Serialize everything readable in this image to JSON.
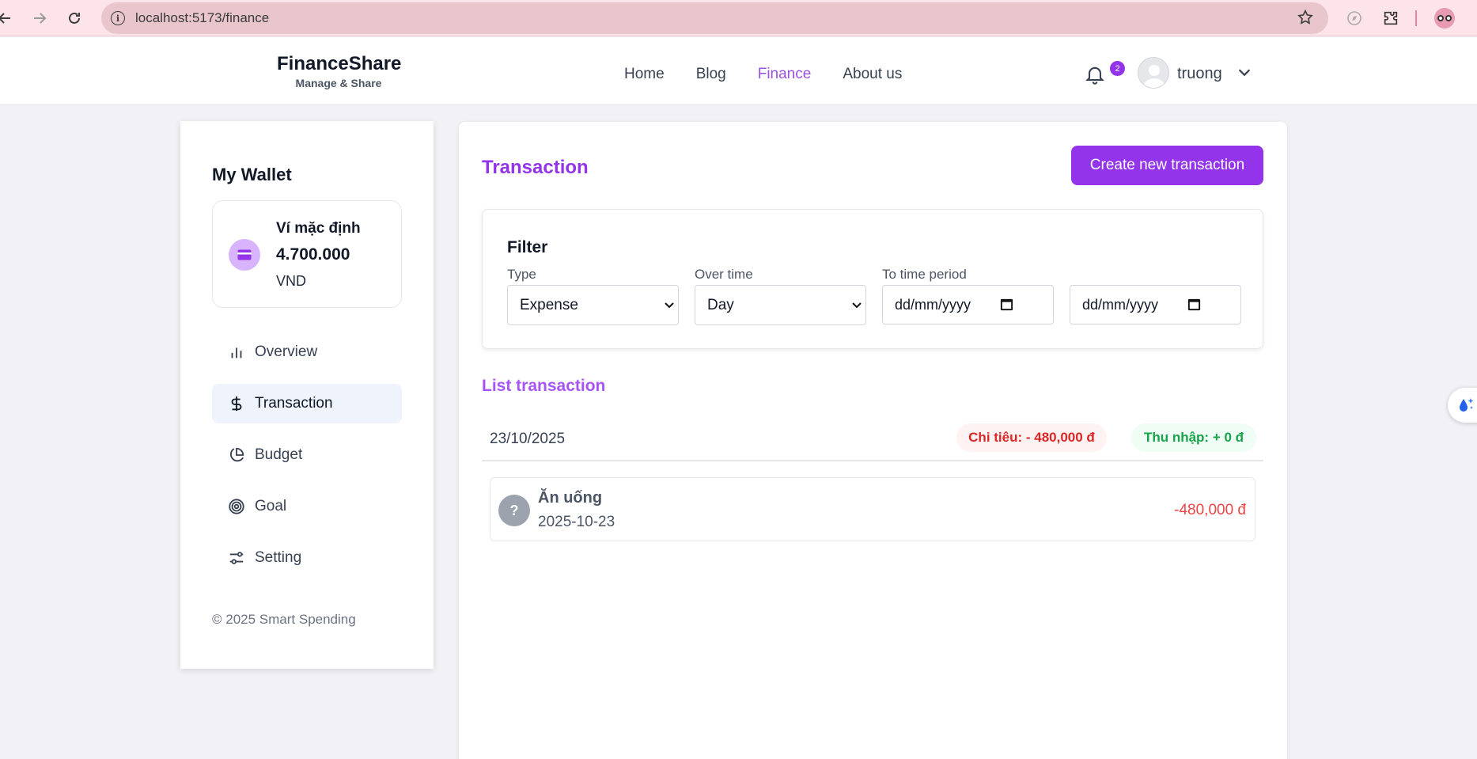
{
  "browser": {
    "url": "localhost:5173/finance",
    "back_icon": "arrow-left-icon",
    "forward_icon": "arrow-right-icon",
    "reload_icon": "reload-icon"
  },
  "header": {
    "brand_name": "FinanceShare",
    "brand_tagline": "Manage & Share",
    "nav": [
      {
        "label": "Home",
        "active": false
      },
      {
        "label": "Blog",
        "active": false
      },
      {
        "label": "Finance",
        "active": true
      },
      {
        "label": "About us",
        "active": false
      }
    ],
    "notification_count": "2",
    "username": "truong"
  },
  "sidebar": {
    "title": "My Wallet",
    "wallet": {
      "name": "Ví mặc định",
      "amount": "4.700.000",
      "currency": "VND"
    },
    "items": [
      {
        "label": "Overview",
        "icon": "bar-chart-icon",
        "active": false
      },
      {
        "label": "Transaction",
        "icon": "dollar-icon",
        "active": true
      },
      {
        "label": "Budget",
        "icon": "pie-chart-icon",
        "active": false
      },
      {
        "label": "Goal",
        "icon": "target-icon",
        "active": false
      },
      {
        "label": "Setting",
        "icon": "sliders-icon",
        "active": false
      }
    ],
    "copyright": "© 2025 Smart Spending"
  },
  "main": {
    "title": "Transaction",
    "create_button": "Create new transaction",
    "filter": {
      "title": "Filter",
      "type_label": "Type",
      "type_value": "Expense",
      "overtime_label": "Over time",
      "overtime_value": "Day",
      "period_label": "To time period",
      "date_from_placeholder": "dd/mm/yyyy",
      "date_to_placeholder": "dd/mm/yyyy"
    },
    "list_title": "List transaction",
    "groups": [
      {
        "date": "23/10/2025",
        "expense_summary": "Chi tiêu: - 480,000 đ",
        "income_summary": "Thu nhập: + 0 đ",
        "transactions": [
          {
            "icon_text": "?",
            "category": "Ăn uống",
            "date": "2025-10-23",
            "amount": "-480,000 đ"
          }
        ]
      }
    ]
  },
  "colors": {
    "accent": "#9333ea",
    "expense": "#dc2626",
    "income": "#16a34a"
  }
}
